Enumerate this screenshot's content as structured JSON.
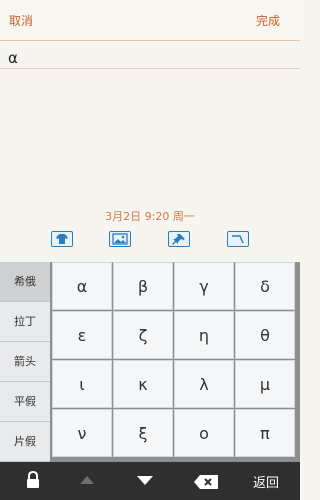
{
  "topbar": {
    "cancel_label": "取消",
    "done_label": "完成"
  },
  "editor": {
    "content": "α"
  },
  "datetime": "3月2日 9:20 周一",
  "tools": [
    {
      "name": "shirt-icon"
    },
    {
      "name": "image-icon"
    },
    {
      "name": "pin-icon"
    },
    {
      "name": "draw-icon"
    }
  ],
  "keyboard": {
    "categories": [
      {
        "label": "希俄",
        "active": true
      },
      {
        "label": "拉丁",
        "active": false
      },
      {
        "label": "箭头",
        "active": false
      },
      {
        "label": "平假",
        "active": false
      },
      {
        "label": "片假",
        "active": false
      }
    ],
    "rows": [
      [
        "α",
        "β",
        "γ",
        "δ"
      ],
      [
        "ε",
        "ζ",
        "η",
        "θ"
      ],
      [
        "ι",
        "κ",
        "λ",
        "μ"
      ],
      [
        "ν",
        "ξ",
        "ο",
        "π"
      ]
    ]
  },
  "bottombar": {
    "back_label": "返回"
  },
  "colors": {
    "accent": "#c8612f",
    "toolblue": "#2f7db8"
  }
}
